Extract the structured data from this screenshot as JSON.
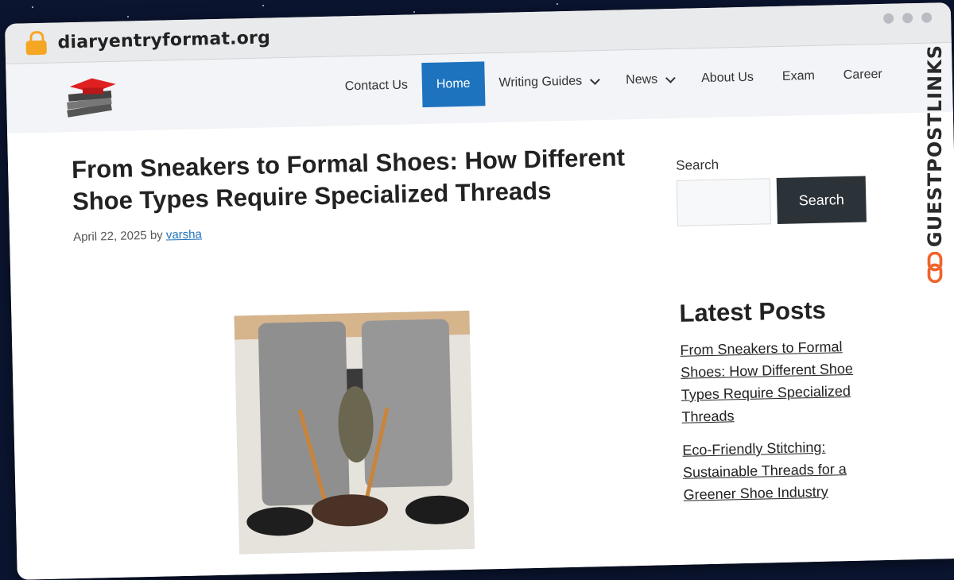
{
  "browser": {
    "url": "diaryentryformat.org"
  },
  "header": {
    "nav": [
      {
        "label": "Contact Us",
        "active": false,
        "dropdown": false
      },
      {
        "label": "Home",
        "active": true,
        "dropdown": false
      },
      {
        "label": "Writing Guides",
        "active": false,
        "dropdown": true
      },
      {
        "label": "News",
        "active": false,
        "dropdown": true
      },
      {
        "label": "About Us",
        "active": false,
        "dropdown": false
      },
      {
        "label": "Exam",
        "active": false,
        "dropdown": false
      },
      {
        "label": "Career",
        "active": false,
        "dropdown": false
      }
    ]
  },
  "article": {
    "title": "From Sneakers to Formal Shoes: How Different Shoe Types Require Specialized Threads",
    "date": "April 22, 2025",
    "by": "by",
    "author": "varsha"
  },
  "sidebar": {
    "search_label": "Search",
    "search_button": "Search",
    "latest_title": "Latest Posts",
    "posts": [
      "From Sneakers to Formal Shoes: How Different Shoe Types Require Specialized Threads",
      "Eco-Friendly Stitching: Sustainable Threads for a Greener Shoe Industry"
    ]
  },
  "brand": {
    "watermark": "GUESTPOSTLINKS"
  },
  "colors": {
    "accent": "#1e73be",
    "search_button": "#2c3338",
    "brand_orange": "#f0642d"
  }
}
